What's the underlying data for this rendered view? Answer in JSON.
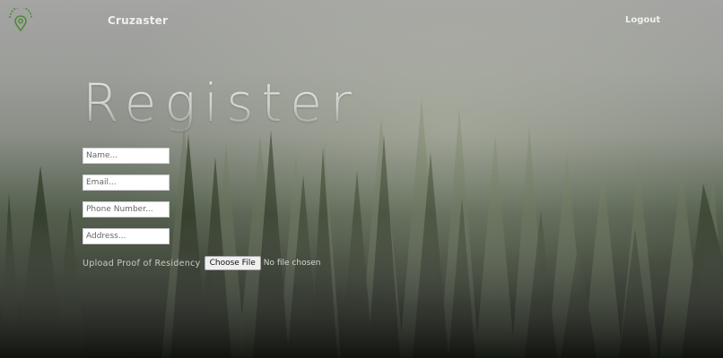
{
  "navbar": {
    "logo_icon": "map-pin-logo-icon",
    "brand": "Cruzaster",
    "logout": "Logout"
  },
  "page": {
    "title": "Register"
  },
  "form": {
    "name_placeholder": "Name...",
    "email_placeholder": "Email...",
    "phone_placeholder": "Phone Number...",
    "address_placeholder": "Address...",
    "upload_label": "Upload Proof of Residency",
    "choose_file_button": "Choose File",
    "file_status": "No file chosen"
  },
  "colors": {
    "logo_green": "#4f8a3a",
    "text_light": "#eef0ea"
  }
}
